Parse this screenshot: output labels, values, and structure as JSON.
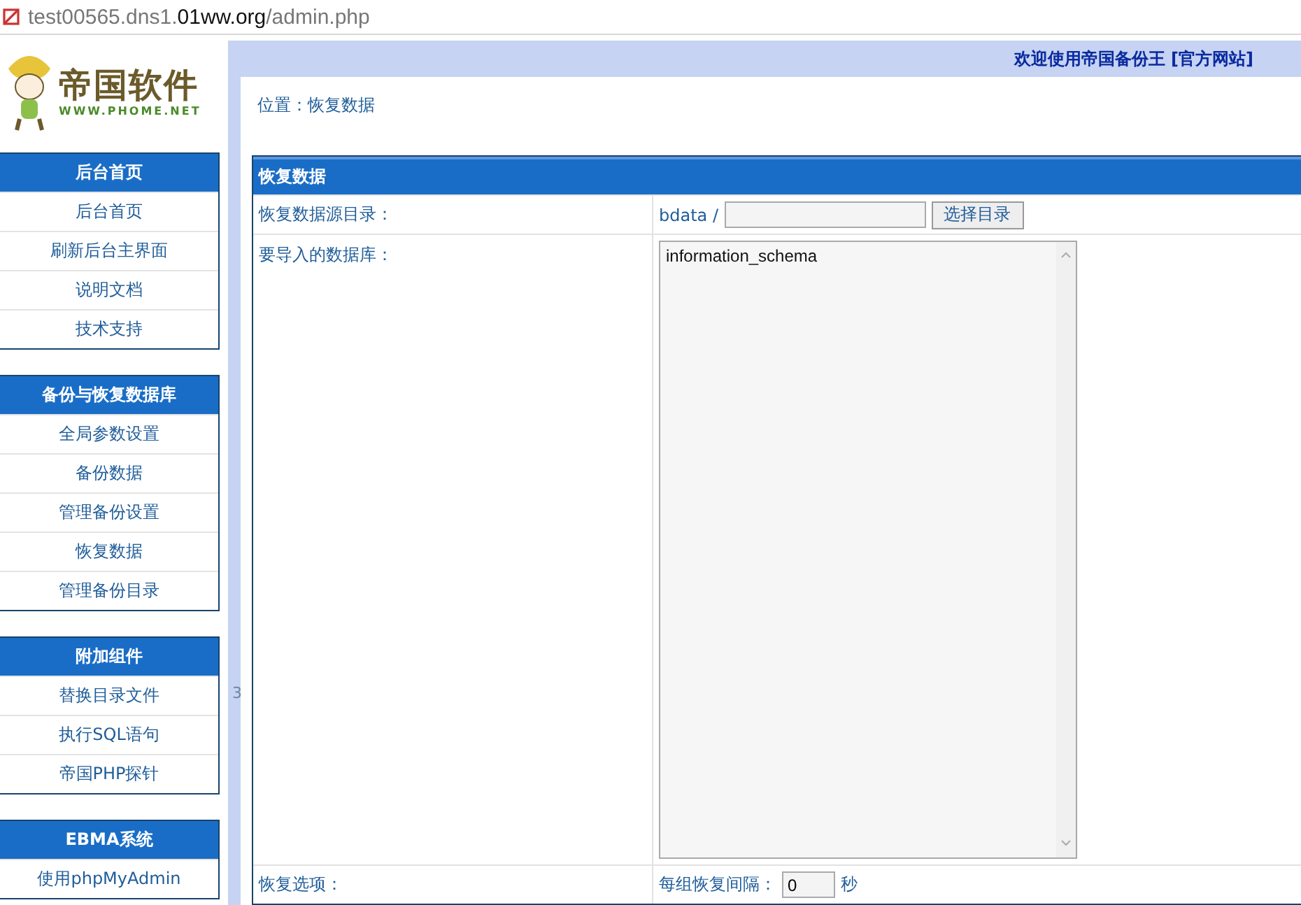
{
  "address_bar": {
    "url": "test00565.dns1.**01ww.org**/admin.php"
  },
  "logo": {
    "name": "帝国软件",
    "site": "WWW.PHOME.NET"
  },
  "sidebar": {
    "sections": [
      {
        "title": "后台首页",
        "items": [
          "后台首页",
          "刷新后台主界面",
          "说明文档",
          "技术支持"
        ]
      },
      {
        "title": "备份与恢复数据库",
        "items": [
          "全局参数设置",
          "备份数据",
          "管理备份设置",
          "恢复数据",
          "管理备份目录"
        ]
      },
      {
        "title": "附加组件",
        "items": [
          "替换目录文件",
          "执行SQL语句",
          "帝国PHP探针"
        ]
      },
      {
        "title": "EBMA系统",
        "items": [
          "使用phpMyAdmin"
        ]
      }
    ]
  },
  "splitter": {
    "label": "3"
  },
  "header": {
    "welcome": "欢迎使用帝国备份王",
    "link": "[官方网站]"
  },
  "breadcrumb": "位置：恢复数据",
  "form": {
    "title": "恢复数据",
    "source_dir": {
      "label": "恢复数据源目录：",
      "prefix": "bdata /",
      "button": "选择目录"
    },
    "databases": {
      "label": "要导入的数据库：",
      "options": [
        "information_schema"
      ]
    },
    "options": {
      "label": "恢复选项：",
      "interval_label": "每组恢复间隔：",
      "interval_value": "0",
      "unit": "秒"
    }
  }
}
